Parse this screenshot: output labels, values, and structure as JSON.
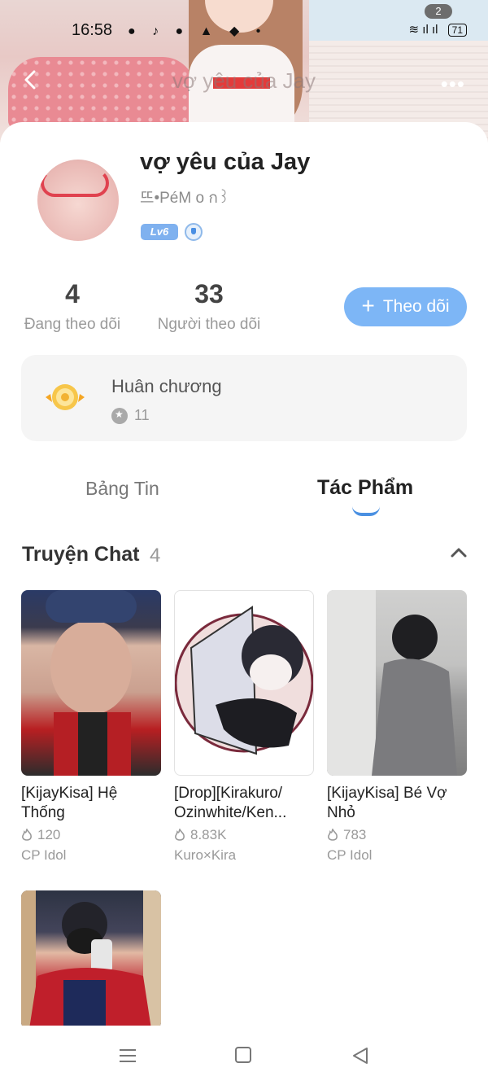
{
  "status_bar": {
    "time": "16:58",
    "notification_count": "2",
    "battery": "71"
  },
  "header": {
    "title": "vợ yêu của Jay"
  },
  "profile": {
    "name": "vợ yêu của Jay",
    "handle": "뜨•PéM o ก꒱",
    "level": "Lv6"
  },
  "stats": {
    "following_count": "4",
    "following_label": "Đang theo dõi",
    "followers_count": "33",
    "followers_label": "Người theo dõi"
  },
  "follow_button": {
    "label": "Theo dõi"
  },
  "medals": {
    "title": "Huân chương",
    "count": "11"
  },
  "tabs": [
    {
      "label": "Bảng Tin",
      "active": false
    },
    {
      "label": "Tác Phẩm",
      "active": true
    }
  ],
  "section": {
    "title": "Truyện Chat",
    "count": "4"
  },
  "stories": [
    {
      "title": "[KijayKisa] Hệ Thống",
      "views": "120",
      "tag": "CP Idol"
    },
    {
      "title": "[Drop][Kirakuro/ Ozinwhite/Ken...",
      "views": "8.83K",
      "tag": "Kuro×Kira"
    },
    {
      "title": "[KijayKisa] Bé Vợ Nhỏ",
      "views": "783",
      "tag": "CP Idol"
    },
    {
      "title": "",
      "views": "",
      "tag": ""
    }
  ],
  "colors": {
    "accent": "#7db6f6",
    "tab_underline": "#4a90e2",
    "level_badge": "#7fb1ef"
  }
}
